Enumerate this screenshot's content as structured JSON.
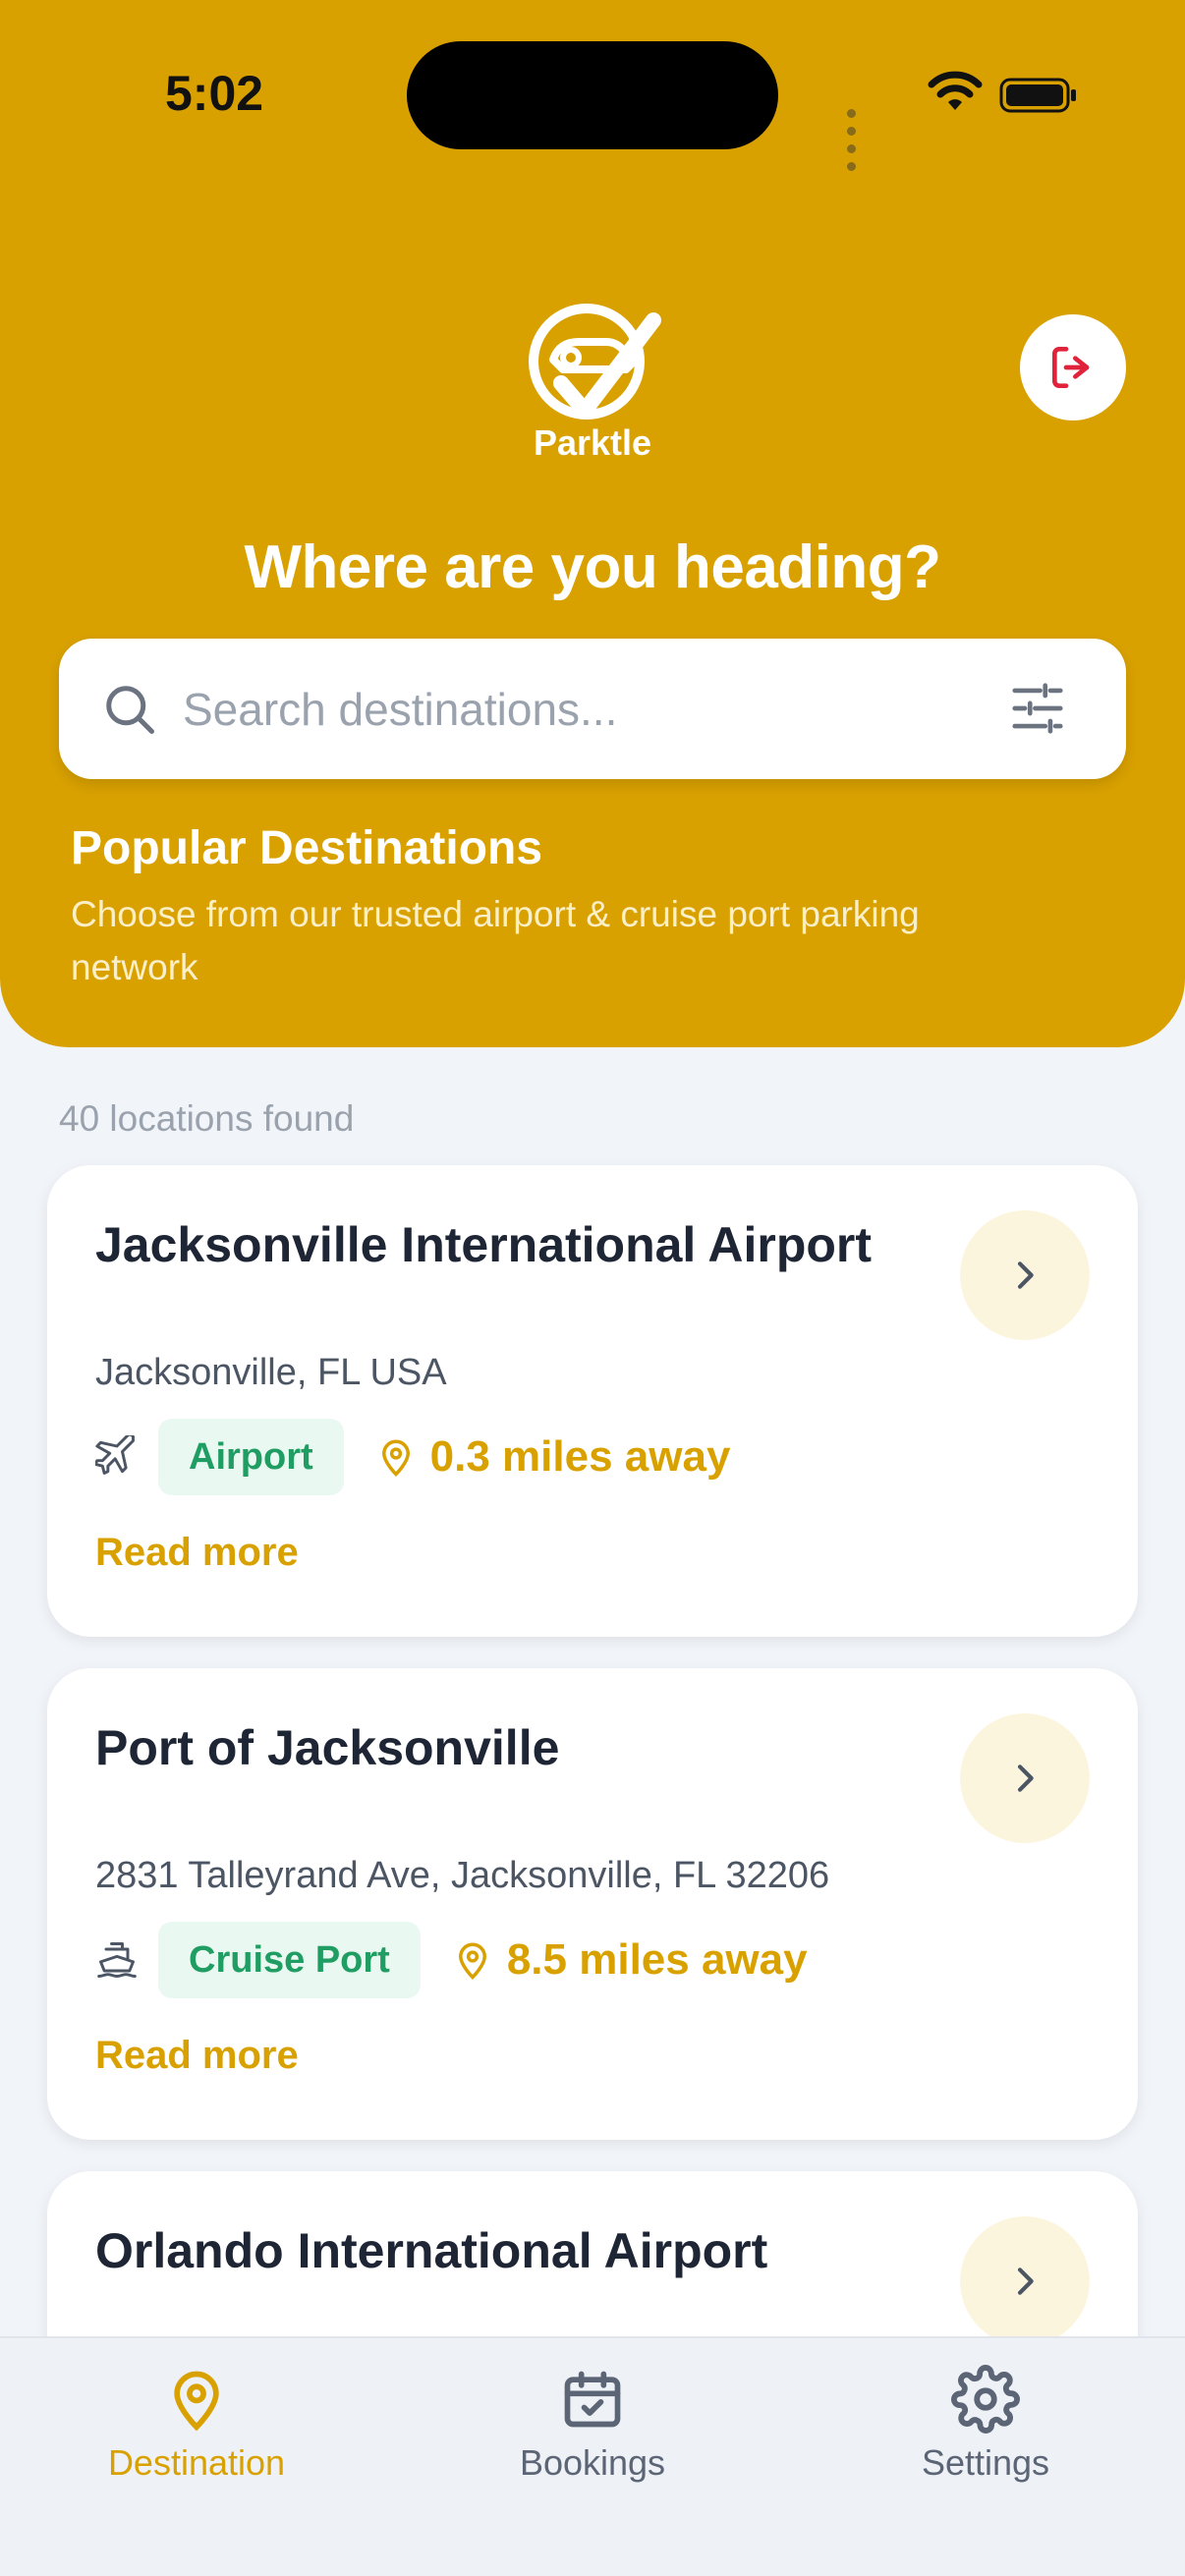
{
  "status_bar": {
    "time": "5:02"
  },
  "header": {
    "brand": "Parktle",
    "heading": "Where are you heading?",
    "logout_icon": "logout-icon"
  },
  "search": {
    "placeholder": "Search destinations...",
    "value": ""
  },
  "popular": {
    "title": "Popular Destinations",
    "subtitle": "Choose from our trusted airport & cruise port parking network"
  },
  "results": {
    "count_text": "40 locations found",
    "items": [
      {
        "name": "Jacksonville International Airport",
        "address": "Jacksonville, FL USA",
        "type": "Airport",
        "type_icon": "airplane-icon",
        "distance": "0.3 miles away",
        "read_more": "Read more"
      },
      {
        "name": "Port of Jacksonville",
        "address": "2831 Talleyrand Ave, Jacksonville, FL 32206",
        "type": "Cruise Port",
        "type_icon": "ship-icon",
        "distance": "8.5 miles away",
        "read_more": "Read more"
      },
      {
        "name": "Orlando International Airport"
      }
    ]
  },
  "tabs": [
    {
      "label": "Destination",
      "icon": "map-pin-icon",
      "active": true
    },
    {
      "label": "Bookings",
      "icon": "calendar-check-icon",
      "active": false
    },
    {
      "label": "Settings",
      "icon": "gear-icon",
      "active": false
    }
  ],
  "colors": {
    "brand": "#d9a100",
    "badge_green": "#1f9d62",
    "badge_bg": "#e9f8f0",
    "logout_red": "#e0223a"
  }
}
